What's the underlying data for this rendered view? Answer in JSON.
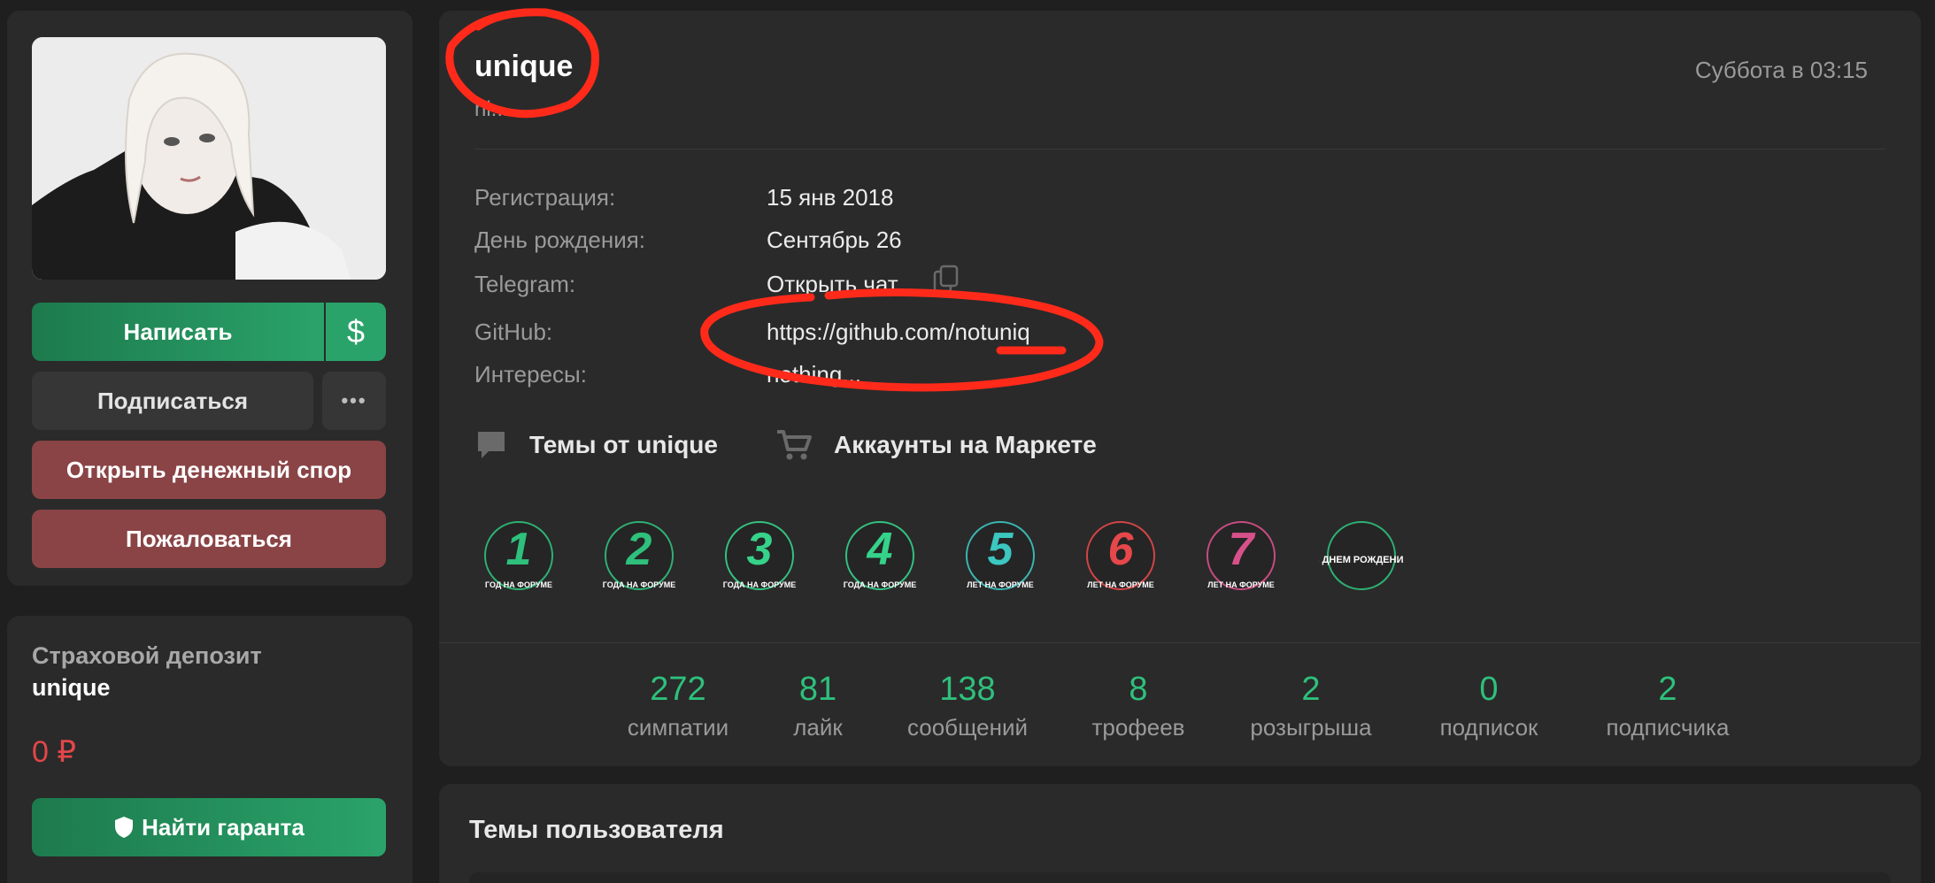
{
  "profile": {
    "username": "unique",
    "status": "hi...",
    "last_seen": "Суббота в 03:15"
  },
  "actions": {
    "write_label": "Написать",
    "dollar_symbol": "$",
    "subscribe_label": "Подписаться",
    "more_symbol": "•••",
    "dispute_label": "Открыть денежный спор",
    "report_label": "Пожаловаться"
  },
  "deposit": {
    "title": "Страховой депозит",
    "username": "unique",
    "amount": "0 ₽",
    "find_guarantor_label": "Найти гаранта"
  },
  "info": [
    {
      "label": "Регистрация:",
      "value": "15 янв 2018"
    },
    {
      "label": "День рождения:",
      "value": "Сентябрь 26"
    },
    {
      "label": "Telegram:",
      "value": "Открыть чат"
    },
    {
      "label": "GitHub:",
      "value": "https://github.com/notuniq"
    },
    {
      "label": "Интересы:",
      "value": "nothing..."
    }
  ],
  "links": {
    "themes_label": "Темы от unique",
    "market_label": "Аккаунты на Маркете"
  },
  "trophies": [
    {
      "number": "1",
      "caption": "ГОД НА ФОРУМЕ",
      "icon": "trophy-1-year-icon",
      "color": "#2ec07c"
    },
    {
      "number": "2",
      "caption": "ГОДА НА ФОРУМЕ",
      "icon": "trophy-2-years-icon",
      "color": "#2ec07c"
    },
    {
      "number": "3",
      "caption": "ГОДА НА ФОРУМЕ",
      "icon": "trophy-3-years-icon",
      "color": "#35d28a"
    },
    {
      "number": "4",
      "caption": "ГОДА НА ФОРУМЕ",
      "icon": "trophy-4-years-icon",
      "color": "#35d28a"
    },
    {
      "number": "5",
      "caption": "ЛЕТ НА ФОРУМЕ",
      "icon": "trophy-5-years-icon",
      "color": "#3cc6c0"
    },
    {
      "number": "6",
      "caption": "ЛЕТ НА ФОРУМЕ",
      "icon": "trophy-6-years-icon",
      "color": "#e6474a"
    },
    {
      "number": "7",
      "caption": "ЛЕТ НА ФОРУМЕ",
      "icon": "trophy-7-years-icon",
      "color": "#d8508a"
    },
    {
      "number": "",
      "caption": "С ДНЕМ РОЖДЕНИЯ",
      "icon": "birthday-cake-icon",
      "color": "#2ec07c"
    }
  ],
  "stats": [
    {
      "value": "272",
      "label": "симпатии"
    },
    {
      "value": "81",
      "label": "лайк"
    },
    {
      "value": "138",
      "label": "сообщений"
    },
    {
      "value": "8",
      "label": "трофеев"
    },
    {
      "value": "2",
      "label": "розыгрыша"
    },
    {
      "value": "0",
      "label": "подписок"
    },
    {
      "value": "2",
      "label": "подписчика"
    }
  ],
  "topics": {
    "title": "Темы пользователя"
  },
  "colors": {
    "accent_green": "#2ec07c",
    "danger_red": "#e2464a",
    "annotation_red": "#ff2a1a",
    "panel_bg": "#2a2a2a",
    "page_bg": "#1f1f1f"
  }
}
